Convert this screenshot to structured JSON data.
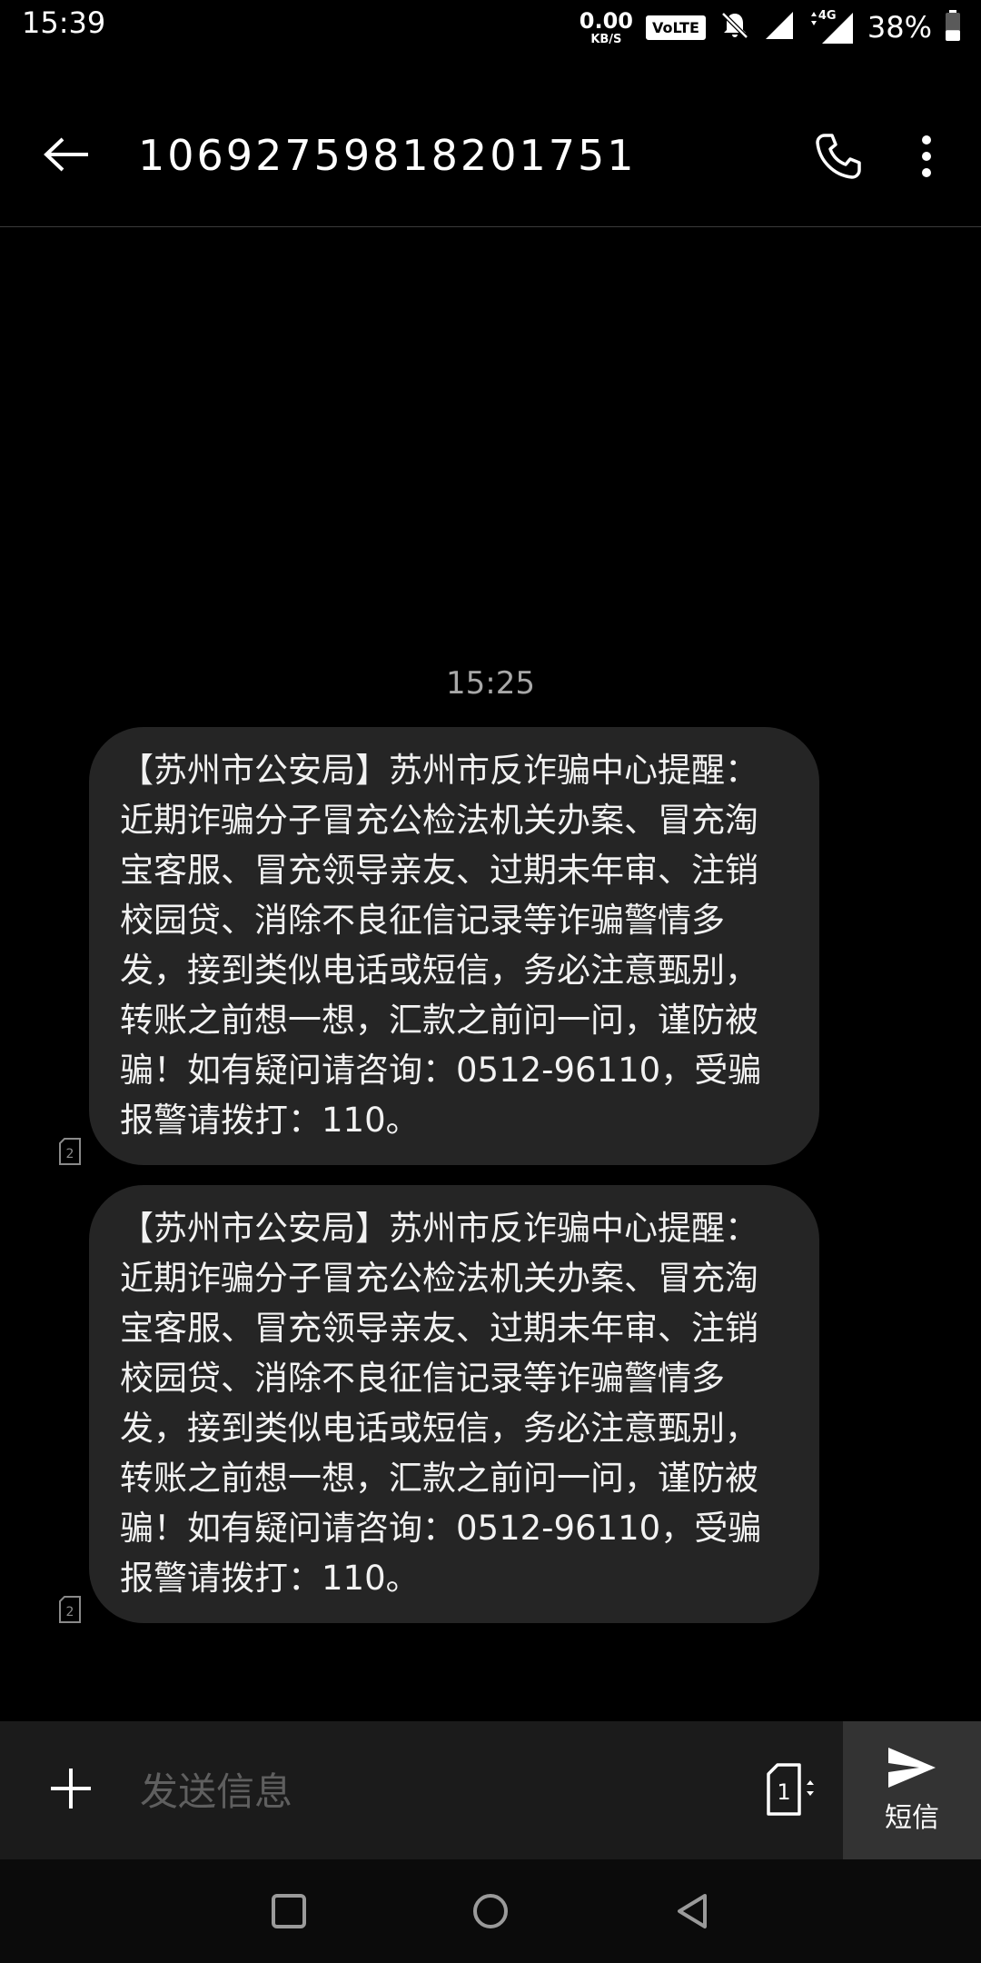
{
  "status_bar": {
    "time": "15:39",
    "net_speed": "0.00",
    "net_speed_unit": "KB/S",
    "volte": "VoLTE",
    "network_type": "4G",
    "battery": "38%",
    "battery_level": 0.38
  },
  "header": {
    "title": "10692759818201751"
  },
  "conversation": {
    "timestamp": "15:25",
    "messages": [
      {
        "text": "【苏州市公安局】苏州市反诈骗中心提醒：近期诈骗分子冒充公检法机关办案、冒充淘宝客服、冒充领导亲友、过期未年审、注销校园贷、消除不良征信记录等诈骗警情多发，接到类似电话或短信，务必注意甄别，转账之前想一想，汇款之前问一问，谨防被骗！如有疑问请咨询：0512-96110，受骗报警请拨打：110。",
        "sim": "2"
      },
      {
        "text": "【苏州市公安局】苏州市反诈骗中心提醒：近期诈骗分子冒充公检法机关办案、冒充淘宝客服、冒充领导亲友、过期未年审、注销校园贷、消除不良征信记录等诈骗警情多发，接到类似电话或短信，务必注意甄别，转账之前想一想，汇款之前问一问，谨防被骗！如有疑问请咨询：0512-96110，受骗报警请拨打：110。",
        "sim": "2"
      }
    ]
  },
  "composer": {
    "placeholder": "发送信息",
    "sim_selected": "1",
    "send_label": "短信"
  },
  "colors": {
    "background": "#000000",
    "bubble": "#252525",
    "composer": "#1b1b1b",
    "send_button": "#333333"
  },
  "icons": [
    "back-arrow-icon",
    "phone-icon",
    "more-vert-icon",
    "plus-icon",
    "sim-card-icon",
    "send-icon",
    "recents-square-icon",
    "home-circle-icon",
    "back-triangle-icon",
    "signal-icon",
    "mute-bell-icon",
    "battery-icon"
  ]
}
